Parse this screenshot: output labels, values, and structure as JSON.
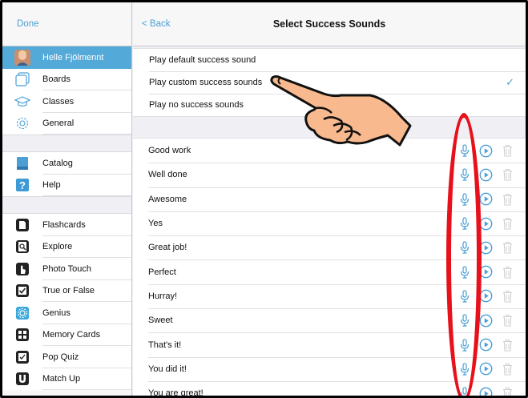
{
  "sidebar": {
    "done_label": "Done",
    "user": {
      "name": "Helle Fjölmennt",
      "icon": "avatar"
    },
    "group1": [
      {
        "label": "Boards",
        "icon": "boards-icon"
      },
      {
        "label": "Classes",
        "icon": "classes-icon"
      },
      {
        "label": "General",
        "icon": "gear-icon"
      }
    ],
    "group2": [
      {
        "label": "Catalog",
        "icon": "catalog-icon"
      },
      {
        "label": "Help",
        "icon": "help-icon"
      }
    ],
    "group3": [
      {
        "label": "Flashcards",
        "icon": "flashcards-icon"
      },
      {
        "label": "Explore",
        "icon": "explore-icon"
      },
      {
        "label": "Photo Touch",
        "icon": "photo-touch-icon"
      },
      {
        "label": "True or False",
        "icon": "true-false-icon"
      },
      {
        "label": "Genius",
        "icon": "genius-icon"
      },
      {
        "label": "Memory Cards",
        "icon": "memory-cards-icon"
      },
      {
        "label": "Pop Quiz",
        "icon": "pop-quiz-icon"
      },
      {
        "label": "Match Up",
        "icon": "match-up-icon"
      }
    ]
  },
  "nav": {
    "back_label": "< Back",
    "title": "Select Success Sounds"
  },
  "options": [
    {
      "label": "Play default success sound",
      "selected": false
    },
    {
      "label": "Play custom success sounds",
      "selected": true,
      "check": "✓"
    },
    {
      "label": "Play no success sounds",
      "selected": false
    }
  ],
  "sounds": [
    {
      "label": "Good work"
    },
    {
      "label": "Well done"
    },
    {
      "label": "Awesome"
    },
    {
      "label": "Yes"
    },
    {
      "label": "Great job!"
    },
    {
      "label": "Perfect"
    },
    {
      "label": "Hurray!"
    },
    {
      "label": "Sweet"
    },
    {
      "label": "That's it!"
    },
    {
      "label": "You did it!"
    },
    {
      "label": "You are great!"
    }
  ],
  "colors": {
    "accent": "#4b9fd5",
    "selected_bg": "#53a9d8",
    "annotation": "#e8101a",
    "hand": "#f8b98e"
  }
}
